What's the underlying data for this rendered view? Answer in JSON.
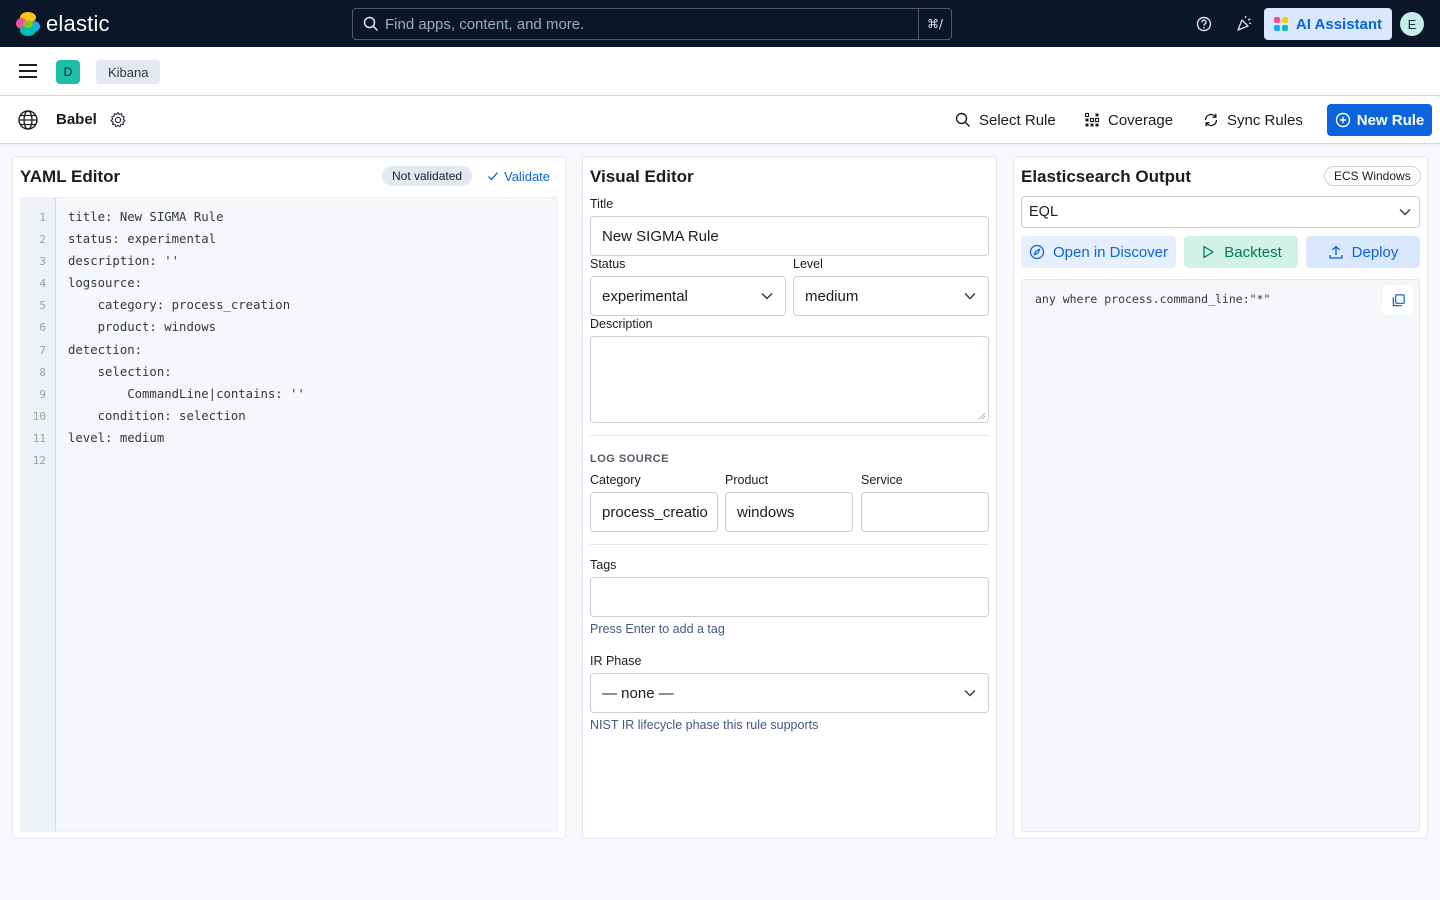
{
  "header": {
    "logo_text": "elastic",
    "search_placeholder": "Find apps, content, and more.",
    "search_shortcut": "⌘/",
    "ai_assistant_label": "AI Assistant",
    "avatar_initial": "E"
  },
  "breadcrumbs": {
    "space_initial": "D",
    "app": "Kibana"
  },
  "app_toolbar": {
    "title": "Babel",
    "select_rule": "Select Rule",
    "coverage": "Coverage",
    "sync_rules": "Sync Rules",
    "new_rule": "New Rule"
  },
  "yaml_editor": {
    "title": "YAML Editor",
    "status_badge": "Not validated",
    "validate_label": "Validate",
    "line_numbers": [
      "1",
      "2",
      "3",
      "4",
      "5",
      "6",
      "7",
      "8",
      "9",
      "10",
      "11",
      "12"
    ],
    "lines": [
      "title: New SIGMA Rule",
      "status: experimental",
      "description: ''",
      "logsource:",
      "    category: process_creation",
      "    product: windows",
      "detection:",
      "    selection:",
      "        CommandLine|contains: ''",
      "    condition: selection",
      "level: medium",
      ""
    ]
  },
  "visual_editor": {
    "title": "Visual Editor",
    "title_label": "Title",
    "title_value": "New SIGMA Rule",
    "status_label": "Status",
    "status_value": "experimental",
    "level_label": "Level",
    "level_value": "medium",
    "description_label": "Description",
    "description_value": "",
    "log_source_heading": "LOG SOURCE",
    "category_label": "Category",
    "category_value": "process_creatio",
    "product_label": "Product",
    "product_value": "windows",
    "service_label": "Service",
    "service_value": "",
    "tags_label": "Tags",
    "tags_value": "",
    "tags_help": "Press Enter to add a tag",
    "ir_phase_label": "IR Phase",
    "ir_phase_value": "— none —",
    "ir_phase_help": "NIST IR lifecycle phase this rule supports"
  },
  "output": {
    "title": "Elasticsearch Output",
    "pipeline_badge": "ECS Windows",
    "language_value": "EQL",
    "open_in_discover": "Open in Discover",
    "backtest": "Backtest",
    "deploy": "Deploy",
    "query": "any where process.command_line:\"*\""
  },
  "colors": {
    "header_bg": "#0b1628",
    "primary": "#0b64dd",
    "page_bg": "#f7f8fc",
    "backtest_bg": "#d1f2e6",
    "backtest_text": "#007d56",
    "accent_light": "#d9e8ff"
  }
}
